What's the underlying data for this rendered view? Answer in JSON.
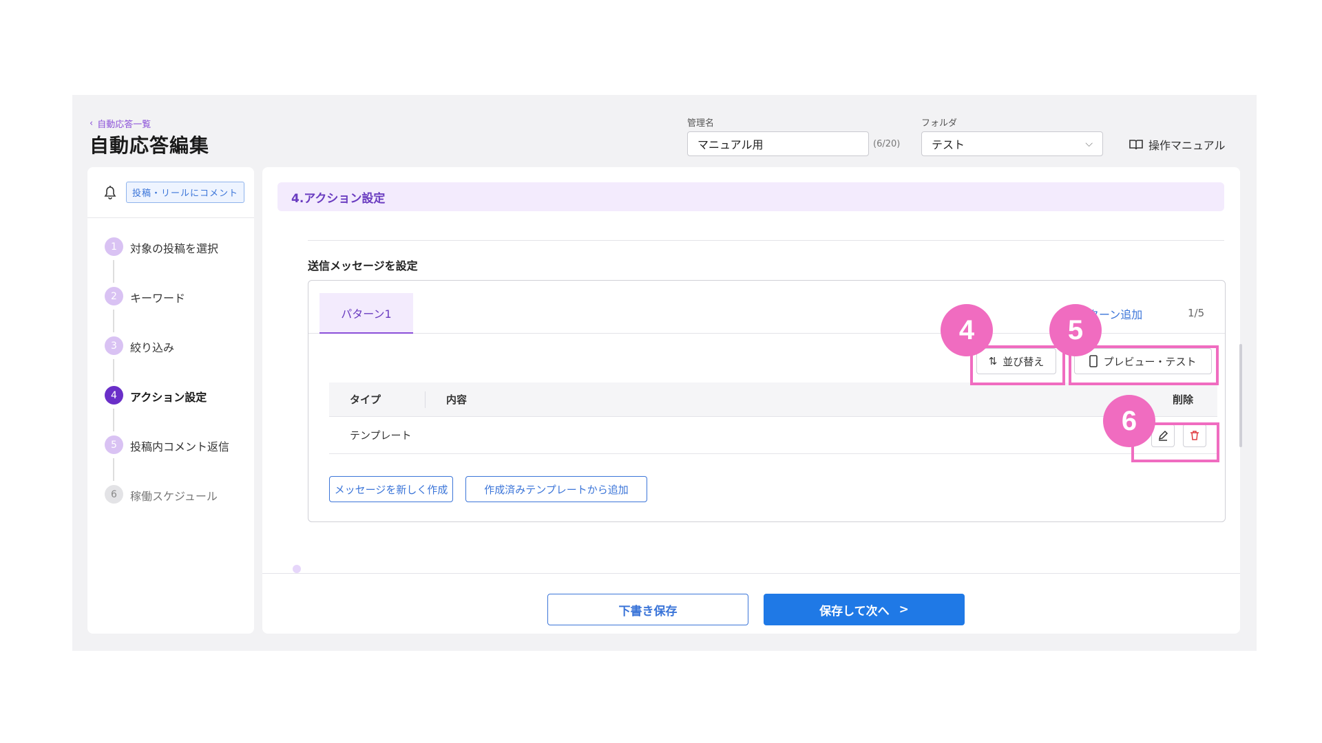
{
  "header": {
    "back_label": "自動応答一覧",
    "title": "自動応答編集",
    "name_label": "管理名",
    "name_value": "マニュアル用",
    "name_counter": "(6/20)",
    "folder_label": "フォルダ",
    "folder_value": "テスト",
    "manual_label": "操作マニュアル"
  },
  "sidebar": {
    "channel_badge": "投稿・リールにコメント",
    "steps": [
      {
        "num": "1",
        "label": "対象の投稿を選択",
        "state": "done"
      },
      {
        "num": "2",
        "label": "キーワード",
        "state": "done"
      },
      {
        "num": "3",
        "label": "絞り込み",
        "state": "done"
      },
      {
        "num": "4",
        "label": "アクション設定",
        "state": "active"
      },
      {
        "num": "5",
        "label": "投稿内コメント返信",
        "state": "done"
      },
      {
        "num": "6",
        "label": "稼働スケジュール",
        "state": "disabled"
      }
    ]
  },
  "main": {
    "section_title": "4.アクション設定",
    "subsection_title": "送信メッセージを設定",
    "tab_label": "パターン1",
    "add_pattern_label": "ターン追加",
    "pattern_count": "1/5",
    "sort_label": "並び替え",
    "preview_label": "プレビュー・テスト",
    "table": {
      "col_type": "タイプ",
      "col_content": "内容",
      "col_delete": "削除",
      "rows": [
        {
          "type": "テンプレート",
          "content": ""
        }
      ]
    },
    "new_message_label": "メッセージを新しく作成",
    "from_template_label": "作成済みテンプレートから追加"
  },
  "footer": {
    "draft_label": "下書き保存",
    "next_label": "保存して次へ"
  },
  "annotations": {
    "marker4": "4",
    "marker5": "5",
    "marker6": "6",
    "color": "#f06cc0"
  },
  "colors": {
    "accent_purple": "#6a2fc8",
    "primary_blue": "#1f79e6"
  }
}
